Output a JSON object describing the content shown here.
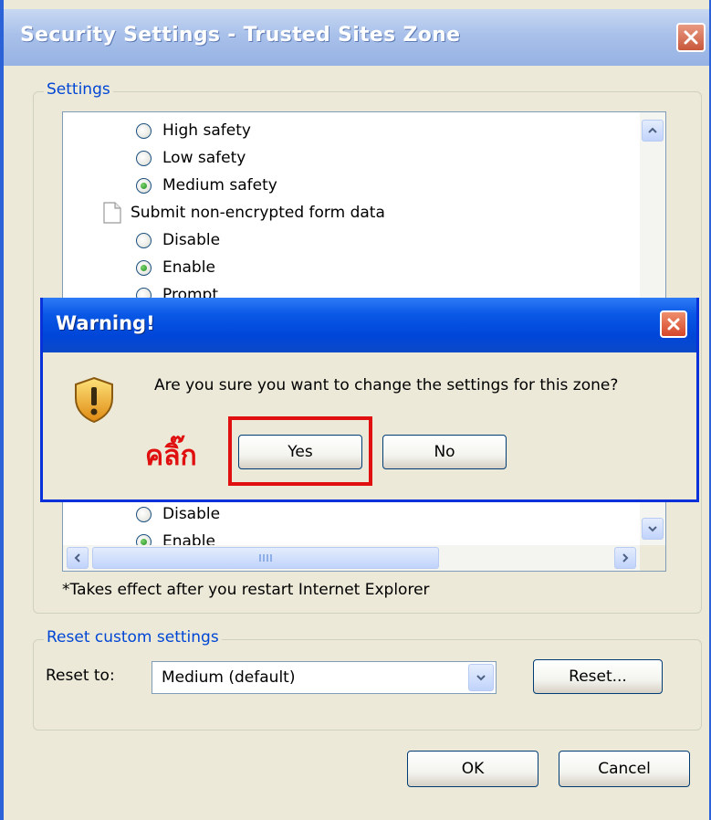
{
  "window": {
    "title": "Security Settings - Trusted Sites Zone",
    "close_glyph": "✕"
  },
  "settings_group": {
    "legend": "Settings",
    "items": [
      {
        "type": "radio",
        "label": "High safety",
        "checked": false
      },
      {
        "type": "radio",
        "label": "Low safety",
        "checked": false
      },
      {
        "type": "radio",
        "label": "Medium safety",
        "checked": true
      },
      {
        "type": "header",
        "label": "Submit non-encrypted form data",
        "icon": "document-icon"
      },
      {
        "type": "radio",
        "label": "Disable",
        "checked": false
      },
      {
        "type": "radio",
        "label": "Enable",
        "checked": true
      },
      {
        "type": "radio",
        "label": "Prompt",
        "checked": false
      },
      {
        "type": "radio",
        "label": "Disable",
        "checked": false
      },
      {
        "type": "radio",
        "label": "Enable",
        "checked": true
      }
    ],
    "note": "*Takes effect after you restart Internet Explorer"
  },
  "reset_group": {
    "legend": "Reset custom settings",
    "reset_to_label": "Reset to:",
    "selected": "Medium (default)",
    "reset_button": "Reset..."
  },
  "buttons": {
    "ok": "OK",
    "cancel": "Cancel"
  },
  "warning_dialog": {
    "title": "Warning!",
    "message": "Are you sure you want to change the settings for this zone?",
    "yes": "Yes",
    "no": "No",
    "annotation": "คลิ๊ก",
    "icon": "warning-shield-icon"
  },
  "colors": {
    "dialog_bg": "#ece9d8",
    "xp_blue": "#0046d8",
    "legend_blue": "#0046d5",
    "highlight_red": "#e01010"
  }
}
